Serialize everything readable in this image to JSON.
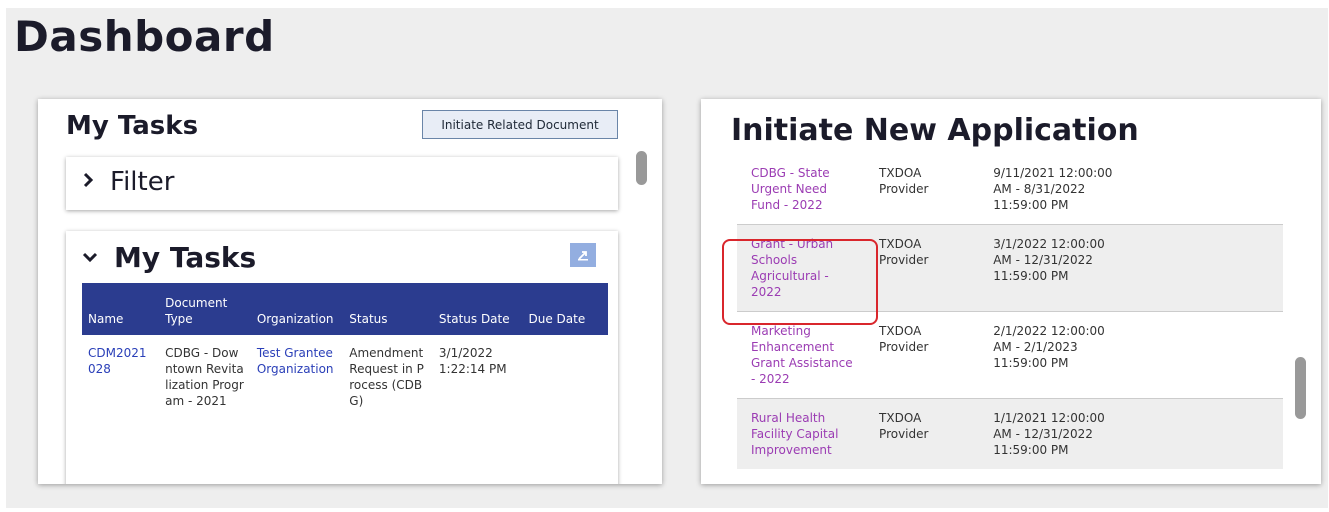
{
  "page": {
    "title": "Dashboard"
  },
  "my_tasks_panel": {
    "heading": "My Tasks",
    "initiate_button": "Initiate Related Document",
    "filter": {
      "title": "Filter"
    },
    "tasks_card": {
      "title": "My Tasks",
      "columns": [
        "Name",
        "Document Type",
        "Organization",
        "Status",
        "Status Date",
        "Due Date"
      ],
      "rows": [
        {
          "name": "CDM2021028",
          "document_type": "CDBG - Downtown Revitalization Program - 2021",
          "organization": "Test Grantee Organization",
          "status": "Amendment Request in Process (CDBG)",
          "status_date": "3/1/2022 1:22:14 PM",
          "due_date": ""
        }
      ]
    }
  },
  "new_application_panel": {
    "heading": "Initiate New Application",
    "rows": [
      {
        "name": "CDBG - State Urgent Need Fund - 2022",
        "provider": "TXDOA Provider",
        "period": "9/11/2021 12:00:00 AM - 8/31/2022 11:59:00 PM"
      },
      {
        "name": "Grant - Urban Schools Agricultural - 2022",
        "provider": "TXDOA Provider",
        "period": "3/1/2022 12:00:00 AM - 12/31/2022 11:59:00 PM"
      },
      {
        "name": "Marketing Enhancement Grant Assistance - 2022",
        "provider": "TXDOA Provider",
        "period": "2/1/2022 12:00:00 AM - 2/1/2023 11:59:00 PM"
      },
      {
        "name": "Rural Health Facility Capital Improvement",
        "provider": "TXDOA Provider",
        "period": "1/1/2021 12:00:00 AM - 12/31/2022 11:59:00 PM"
      }
    ]
  },
  "icons": {
    "filter_chevron": "chevron-right-icon",
    "tasks_chevron": "chevron-down-icon",
    "export": "export-icon"
  },
  "colors": {
    "table_header": "#2b3c8f",
    "link": "#2a3fb8",
    "app_link": "#9b3cb3",
    "highlight": "#d9262c"
  }
}
